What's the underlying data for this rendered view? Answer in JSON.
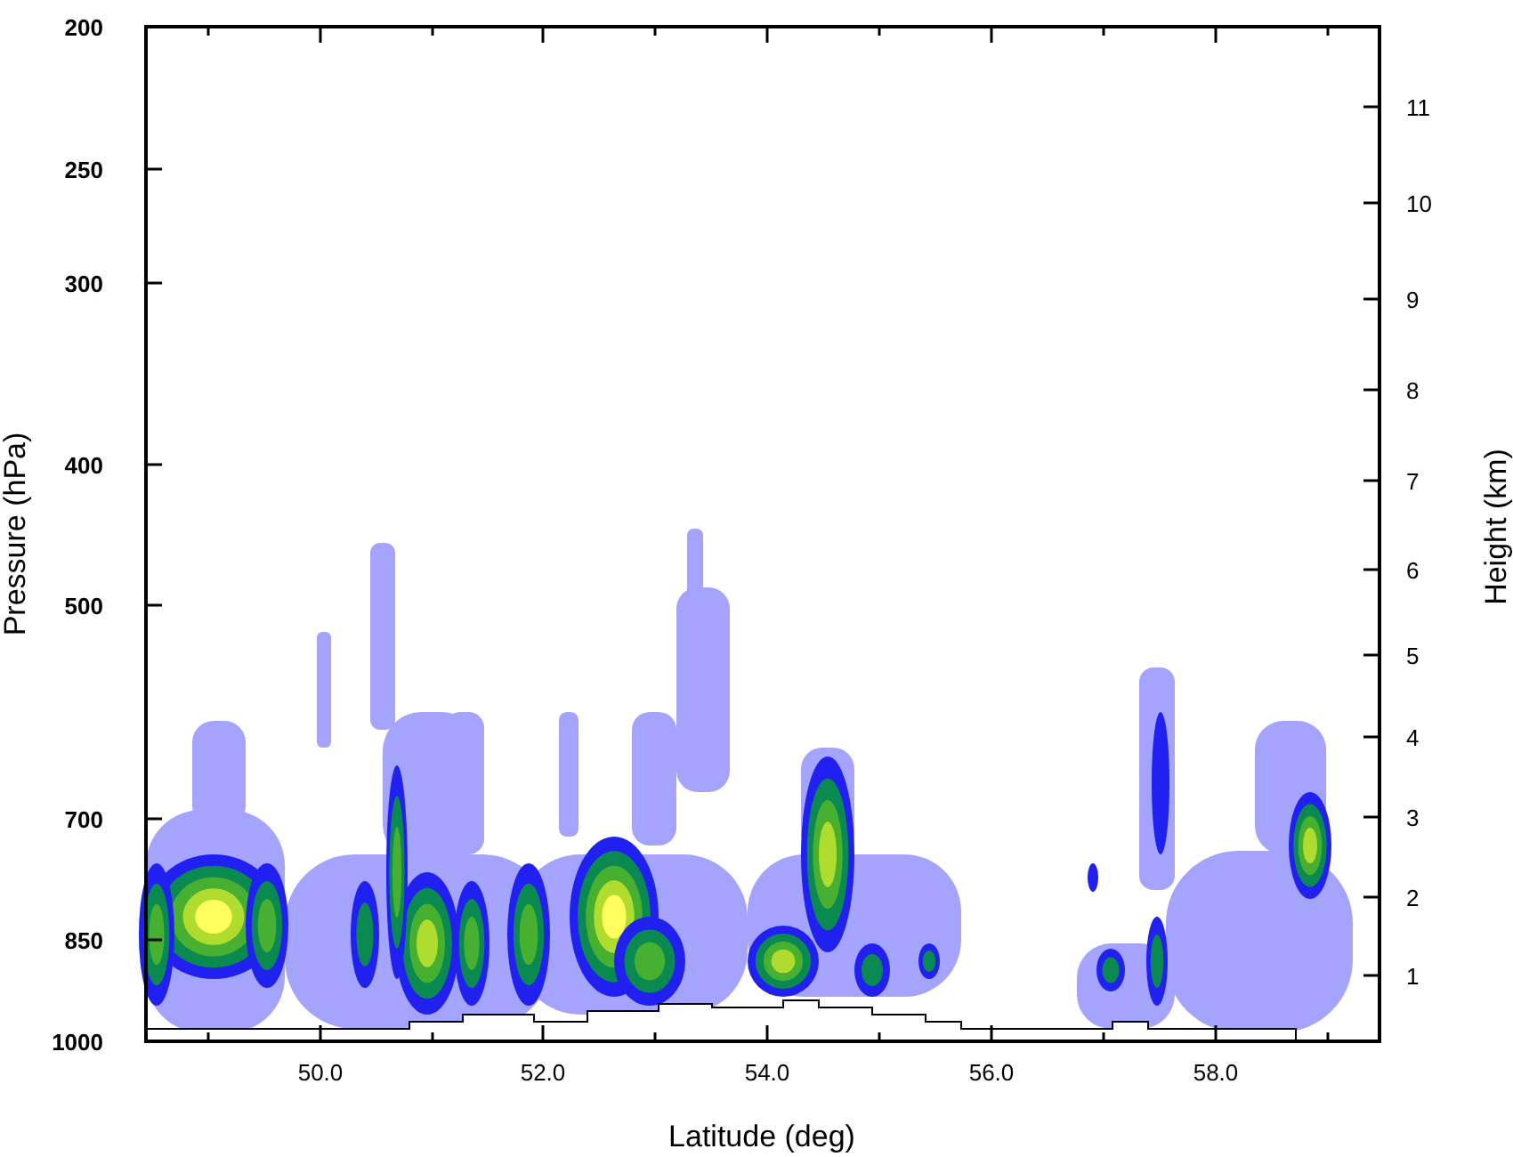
{
  "plot": {
    "xlabel": "Latitude (deg)",
    "ylabel_left": "Pressure (hPa)",
    "ylabel_right": "Height (km)",
    "x_ticks": [
      "50.0",
      "52.0",
      "54.0",
      "56.0",
      "58.0"
    ],
    "left_ticks": [
      "200",
      "250",
      "300",
      "400",
      "500",
      "700",
      "850",
      "1000"
    ],
    "right_ticks": [
      "11",
      "10",
      "9",
      "8",
      "7",
      "6",
      "5",
      "4",
      "3",
      "2",
      "1"
    ]
  }
}
